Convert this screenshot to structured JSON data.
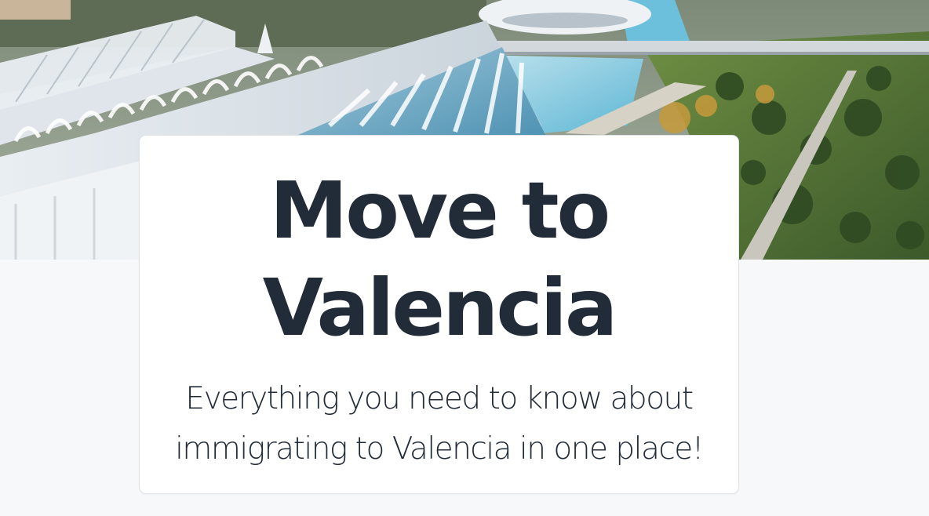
{
  "hero": {
    "image": "valencia-city-of-arts-and-sciences-aerial"
  },
  "card": {
    "title_line1": "Move to",
    "title_line2": "Valencia",
    "subtitle_line1": "Everything you need to know about",
    "subtitle_line2": "immigrating to Valencia in one place!"
  },
  "colors": {
    "page_background": "#f6f8fa",
    "card_background": "#ffffff",
    "card_border": "#dfe3e8",
    "text": "#222b38"
  }
}
